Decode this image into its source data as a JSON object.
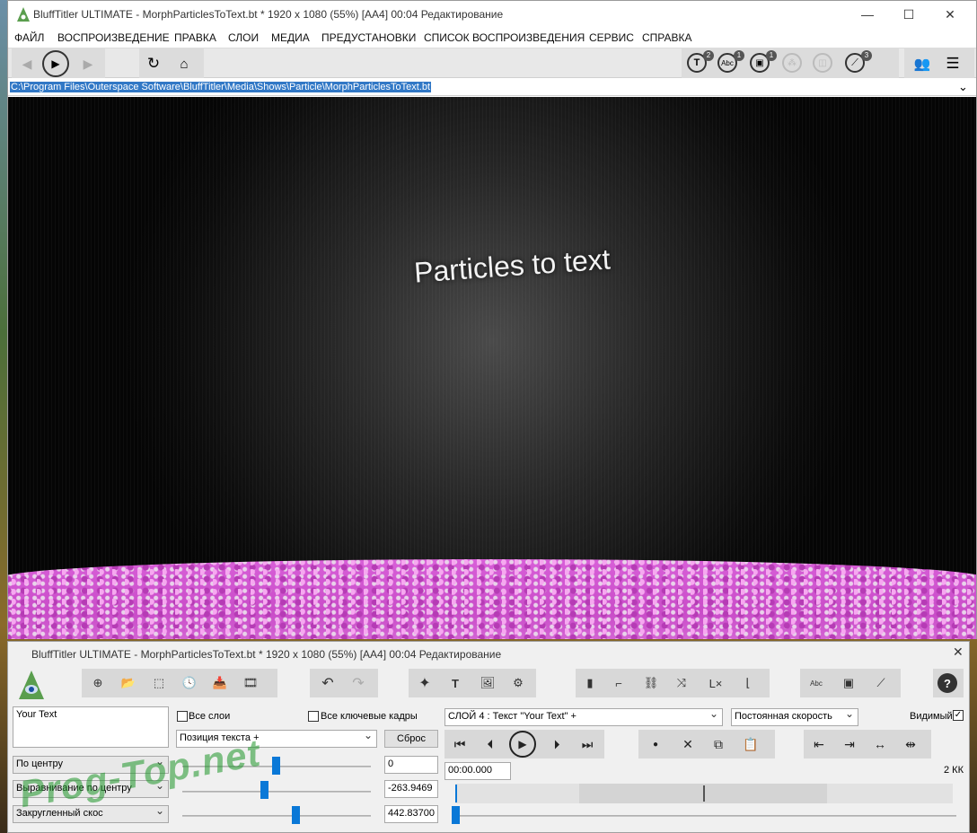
{
  "main_window": {
    "title": "BluffTitler ULTIMATE  - MorphParticlesToText.bt * 1920 x 1080 (55%) [AA4] 00:04 Редактирование",
    "controls": {
      "minimize": "—",
      "maximize": "☐",
      "close": "✕"
    }
  },
  "menu": [
    "ФАЙЛ",
    "ВОСПРОИЗВЕДЕНИЕ",
    "ПРАВКА",
    "СЛОИ",
    "МЕДИА",
    "ПРЕДУСТАНОВКИ",
    "СПИСОК ВОСПРОИЗВЕДЕНИЯ",
    "СЕРВИС",
    "СПРАВКА"
  ],
  "toolbar": {
    "badges": {
      "text_layers": "2",
      "abc_layers": "1",
      "image_layers": "1",
      "effect_layers": "3"
    }
  },
  "path": "C:\\Program Files\\Outerspace Software\\BluffTitler\\Media\\Shows\\Particle\\MorphParticlesToText.bt",
  "viewport": {
    "scene_text": "Particles to text"
  },
  "panel": {
    "title": "BluffTitler ULTIMATE  - MorphParticlesToText.bt * 1920 x 1080 (55%) [AA4] 00:04 Редактирование",
    "text_value": "Your Text",
    "all_layers_label": "Все слои",
    "all_keyframes_label": "Все ключевые кадры",
    "property_select": "Позиция текста +",
    "reset_label": "Сброс",
    "layer_select": "СЛОЙ 4  : Текст \"Your Text\" +",
    "speed_select": "Постоянная скорость",
    "visible_label": "Видимый",
    "combo1": "По центру",
    "combo2": "Выравнивание по центру",
    "combo3": "Закругленный скос",
    "value1": "0",
    "value2": "-263.9469",
    "value3": "442.83700",
    "time_value": "00:00.000",
    "kk_label": "2 КК"
  },
  "watermark": "Prog-Top.net",
  "colors": {
    "accent": "#0a78d7",
    "selection": "#3178c6",
    "particles": "#d85fd8"
  }
}
